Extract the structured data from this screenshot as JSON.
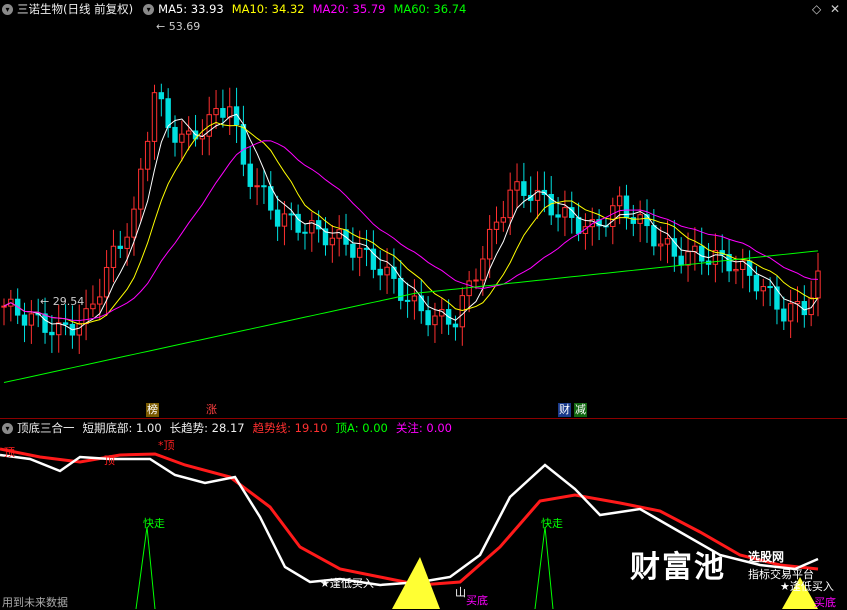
{
  "main_header": {
    "title": "三诺生物(日线 前复权)",
    "ma5": "MA5: 33.93",
    "ma10": "MA10: 34.32",
    "ma20": "MA20: 35.79",
    "ma60": "MA60: 36.74",
    "colors": {
      "ma5": "#ffffff",
      "ma10": "#ffff00",
      "ma20": "#ff00ff",
      "ma60": "#00ff00"
    }
  },
  "annotations": {
    "high": "53.69",
    "low": "29.54"
  },
  "event_tags": [
    {
      "text": "榜"
    },
    {
      "text": "涨"
    },
    {
      "text": "财"
    },
    {
      "text": "减"
    }
  ],
  "indicator_header": {
    "name": "顶底三合一",
    "short_bottom": "短期底部: 1.00",
    "long_trend": "长趋势: 28.17",
    "trend_line": "趋势线: 19.10",
    "top_a": "顶A: 0.00",
    "focus": "关注: 0.00"
  },
  "indicator_labels": {
    "top1": "顶",
    "top2": "顶",
    "top3": "*顶",
    "fast1": "快走",
    "fast2": "快走",
    "buy": "逢低买入",
    "buy2": "逢低买入",
    "bottom1": "底",
    "bottom2": "底",
    "shan": "山",
    "buy_bottom": "买底",
    "buy_bottom2": "买底"
  },
  "watermark": {
    "brand": "财富池",
    "line1": "选股网",
    "line2": "指标交易平台"
  },
  "footer_text": "用到未来数据",
  "chart_data": {
    "type": "candlestick",
    "title": "三诺生物(日线 前复权)",
    "annotated_high": 53.69,
    "annotated_low": 29.54,
    "ylim": [
      25,
      55
    ],
    "ma_last": {
      "MA5": 33.93,
      "MA10": 34.32,
      "MA20": 35.79,
      "MA60": 36.74
    },
    "series_count": 120
  }
}
